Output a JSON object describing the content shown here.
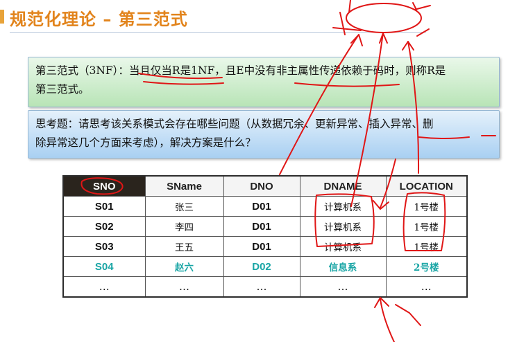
{
  "slide": {
    "title": "规范化理论 – 第三范式",
    "definition_line1": "第三范式（3NF）：当且仅当R是1NF，且E中没有非主属性传递依赖于码时，则称R是",
    "definition_line2": "第三范式。",
    "question_line1": "思考题：请思考该关系模式会存在哪些问题（从数据冗余、更新异常、插入异常、删",
    "question_line2": "除异常这几个方面来考虑），解决方案是什么？"
  },
  "table": {
    "headers": [
      "SNO",
      "SName",
      "DNO",
      "DNAME",
      "LOCATION"
    ],
    "rows": [
      [
        "S01",
        "张三",
        "D01",
        "计算机系",
        "1号楼"
      ],
      [
        "S02",
        "李四",
        "D01",
        "计算机系",
        "1号楼"
      ],
      [
        "S03",
        "王五",
        "D01",
        "计算机系",
        "1号楼"
      ],
      [
        "S04",
        "赵六",
        "D02",
        "信息系",
        "2号楼"
      ],
      [
        "…",
        "…",
        "…",
        "…",
        "…"
      ]
    ]
  },
  "colors": {
    "title": "#e2841c",
    "highlight_row": "#19a5a5",
    "annotation_ink": "#e01616"
  }
}
